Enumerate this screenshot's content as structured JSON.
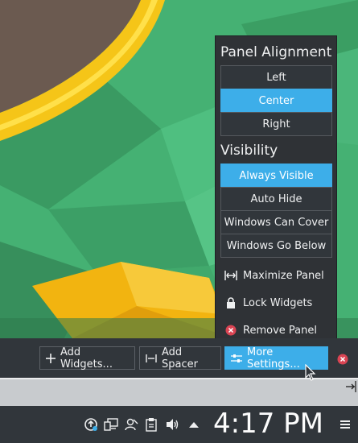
{
  "menu": {
    "alignment": {
      "title": "Panel Alignment",
      "options": [
        "Left",
        "Center",
        "Right"
      ],
      "selected": "Center"
    },
    "visibility": {
      "title": "Visibility",
      "options": [
        "Always Visible",
        "Auto Hide",
        "Windows Can Cover",
        "Windows Go Below"
      ],
      "selected": "Always Visible"
    },
    "actions": {
      "maximize": "Maximize Panel",
      "lock": "Lock Widgets",
      "remove": "Remove Panel"
    }
  },
  "toolbar": {
    "add_widgets": "Add Widgets...",
    "add_spacer": "Add Spacer",
    "more_settings": "More Settings..."
  },
  "taskbar": {
    "time": "4:17 PM"
  },
  "colors": {
    "accent": "#3daee9",
    "panel": "#31363b",
    "close_red": "#da4453"
  }
}
